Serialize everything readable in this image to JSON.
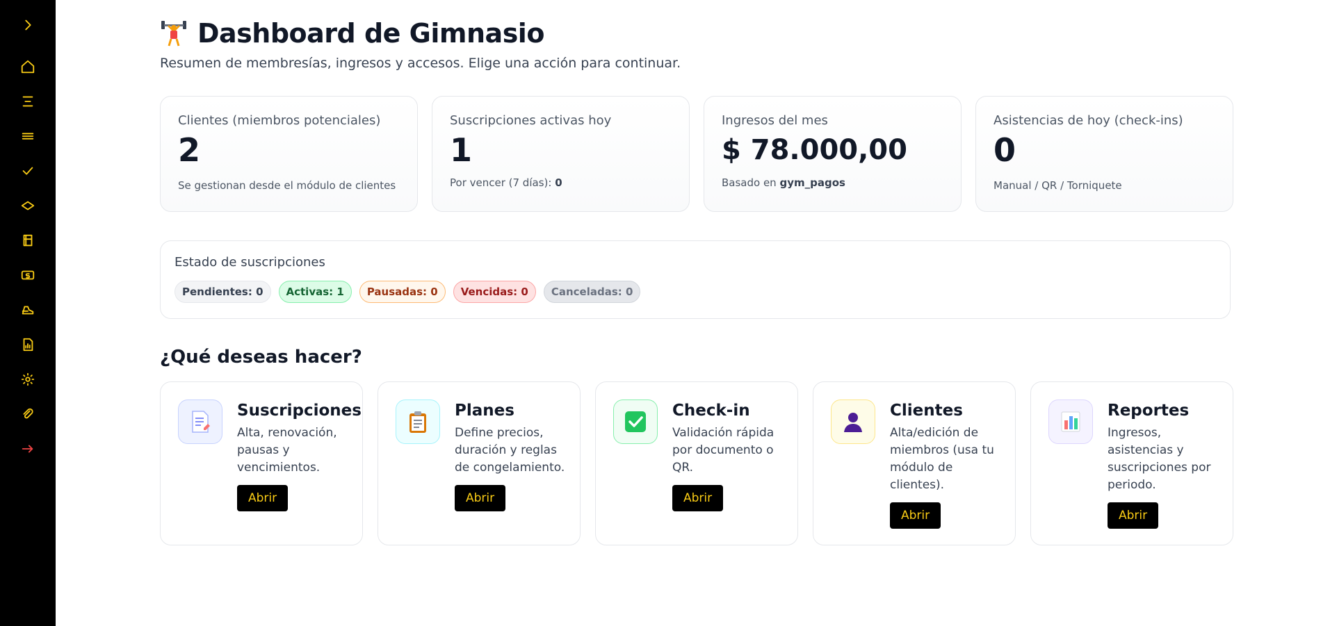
{
  "sidebar": {
    "items": [
      {
        "icon": "chevron-right-icon"
      },
      {
        "icon": "home-icon"
      },
      {
        "icon": "menu-align-icon"
      },
      {
        "icon": "list-icon"
      },
      {
        "icon": "check-icon"
      },
      {
        "icon": "diamond-icon"
      },
      {
        "icon": "cart-icon"
      },
      {
        "icon": "cash-icon"
      },
      {
        "icon": "user-shoe-icon"
      },
      {
        "icon": "report-icon"
      },
      {
        "icon": "sun-settings-icon"
      },
      {
        "icon": "paperclip-icon"
      },
      {
        "icon": "logout-arrow-icon"
      }
    ]
  },
  "header": {
    "title": "Dashboard de Gimnasio",
    "subtitle": "Resumen de membresías, ingresos y accesos. Elige una acción para continuar."
  },
  "kpis": [
    {
      "label": "Clientes (miembros potenciales)",
      "value": "2",
      "note": "Se gestionan desde el módulo de clientes"
    },
    {
      "label": "Suscripciones activas hoy",
      "value": "1",
      "note_prefix": "Por vencer (7 días): ",
      "note_bold": "0"
    },
    {
      "label": "Ingresos del mes",
      "value": "$ 78.000,00",
      "note_prefix": "Basado en ",
      "note_bold": "gym_pagos"
    },
    {
      "label": "Asistencias de hoy (check-ins)",
      "value": "0",
      "note": "Manual / QR / Torniquete"
    }
  ],
  "status": {
    "title": "Estado de suscripciones",
    "pills": {
      "pending": "Pendientes: 0",
      "active": "Activas: 1",
      "paused": "Pausadas: 0",
      "expired": "Vencidas: 0",
      "cancelled": "Canceladas: 0"
    }
  },
  "actions_title": "¿Qué deseas hacer?",
  "actions": [
    {
      "title": "Suscripciones",
      "desc": "Alta, renovación, pausas y vencimientos.",
      "button": "Abrir",
      "icon": "document-icon"
    },
    {
      "title": "Planes",
      "desc": "Define precios, duración y reglas de congelamiento.",
      "button": "Abrir",
      "icon": "clipboard-icon"
    },
    {
      "title": "Check-in",
      "desc": "Validación rápida por documento o QR.",
      "button": "Abrir",
      "icon": "checkbox-icon"
    },
    {
      "title": "Clientes",
      "desc": "Alta/edición de miembros (usa tu módulo de clientes).",
      "button": "Abrir",
      "icon": "person-icon"
    },
    {
      "title": "Reportes",
      "desc": "Ingresos, asistencias y suscripciones por periodo.",
      "button": "Abrir",
      "icon": "bar-chart-icon"
    }
  ],
  "colors": {
    "sidebar_bg": "#000000",
    "sidebar_icon": "#facc15",
    "logout_icon": "#ef4444",
    "button_bg": "#000000",
    "button_text": "#facc15"
  }
}
